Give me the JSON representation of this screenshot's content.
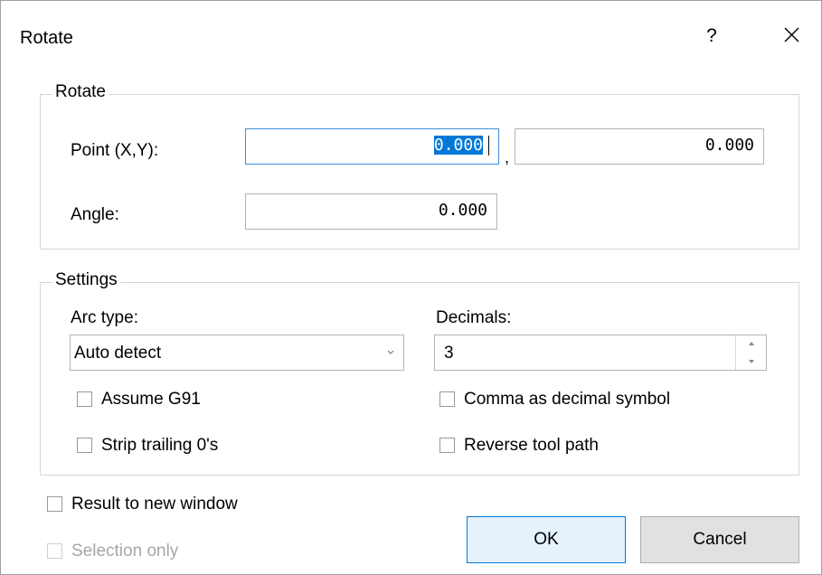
{
  "dialog": {
    "title": "Rotate",
    "help_label": "?",
    "close_icon": "close-icon"
  },
  "rotate_group": {
    "legend": "Rotate",
    "point_label": "Point (X,Y):",
    "point_x": "0.000",
    "point_separator": ",",
    "point_y": "0.000",
    "angle_label": "Angle:",
    "angle_value": "0.000"
  },
  "settings_group": {
    "legend": "Settings",
    "arc_type_label": "Arc type:",
    "arc_type_value": "Auto detect",
    "decimals_label": "Decimals:",
    "decimals_value": "3",
    "assume_g91": {
      "label": "Assume G91",
      "checked": false
    },
    "strip_trailing": {
      "label": "Strip trailing 0's",
      "checked": false
    },
    "comma_decimal": {
      "label": "Comma as decimal symbol",
      "checked": false
    },
    "reverse_path": {
      "label": "Reverse tool path",
      "checked": false
    }
  },
  "options": {
    "result_new_window": {
      "label": "Result to new window",
      "checked": false
    },
    "selection_only": {
      "label": "Selection only",
      "checked": false,
      "disabled": true
    }
  },
  "buttons": {
    "ok": "OK",
    "cancel": "Cancel"
  },
  "colors": {
    "selection_highlight": "#0078d7",
    "focus_border": "#3c8fd8",
    "default_button_border": "#0078d7"
  }
}
